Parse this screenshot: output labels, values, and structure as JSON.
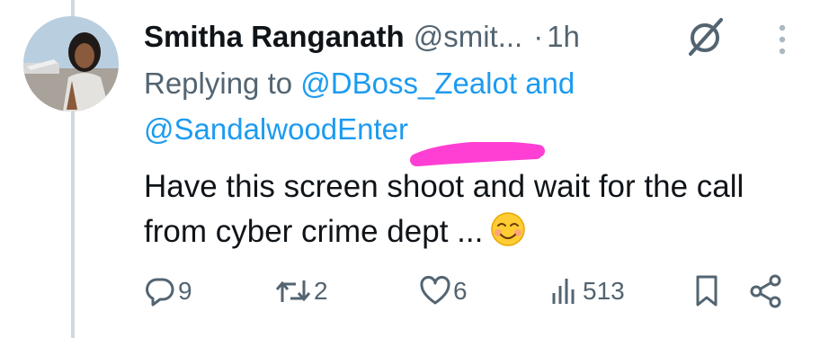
{
  "tweet": {
    "author_name": "Smitha Ranganath",
    "author_handle": "@smit...",
    "separator": "·",
    "time": "1h",
    "replying_prefix": "Replying to ",
    "mention_1": "@DBoss_Zealot",
    "and_word": " and",
    "mention_2": "@SandalwoodEnter",
    "text": "Have this screen shoot and wait for the call from cyber crime dept ...",
    "emoji": "☺️"
  },
  "actions": {
    "reply_count": "9",
    "retweet_count": "2",
    "like_count": "6",
    "view_count": "513"
  },
  "icons": [
    "avatar",
    "grok-icon",
    "more-icon",
    "reply-icon",
    "retweet-icon",
    "like-icon",
    "views-icon",
    "bookmark-icon",
    "share-icon"
  ],
  "colors": {
    "link": "#1d9bf0",
    "secondary_text": "#536471",
    "highlighter": "#ff3fd4",
    "thread_line": "#cfd9de"
  }
}
